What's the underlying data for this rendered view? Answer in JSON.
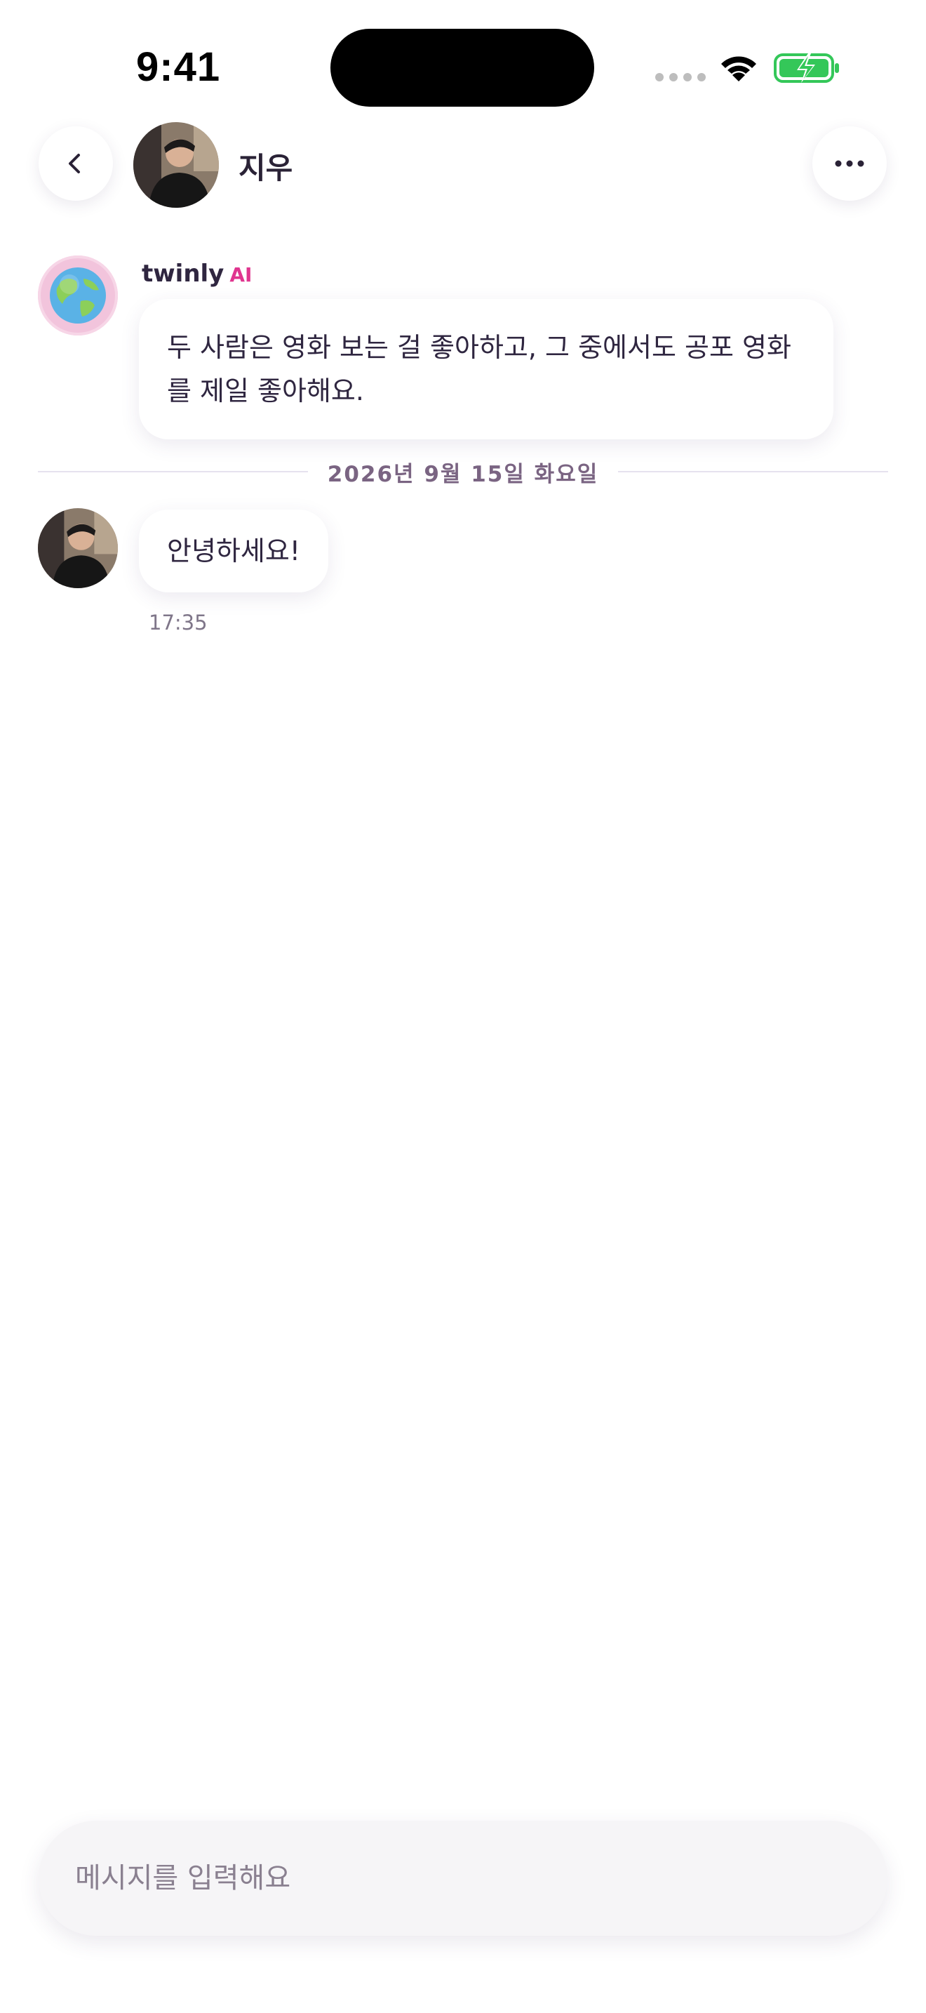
{
  "status_bar": {
    "time": "9:41"
  },
  "header": {
    "contact_name": "지우",
    "back_icon": "chevron-left-icon",
    "more_icon": "ellipsis-icon"
  },
  "messages": {
    "ai": {
      "sender": "twinly",
      "tag": "AI",
      "avatar_icon": "globe-icon",
      "text": "두 사람은 영화 보는 걸 좋아하고, 그 중에서도 공포 영화를 제일 좋아해요."
    },
    "date_divider": "2026년 9월 15일 화요일",
    "user": {
      "text": "안녕하세요!",
      "time": "17:35"
    }
  },
  "composer": {
    "placeholder": "메시지를 입력해요"
  },
  "colors": {
    "accent": "#e0358f",
    "battery": "#34c759"
  }
}
